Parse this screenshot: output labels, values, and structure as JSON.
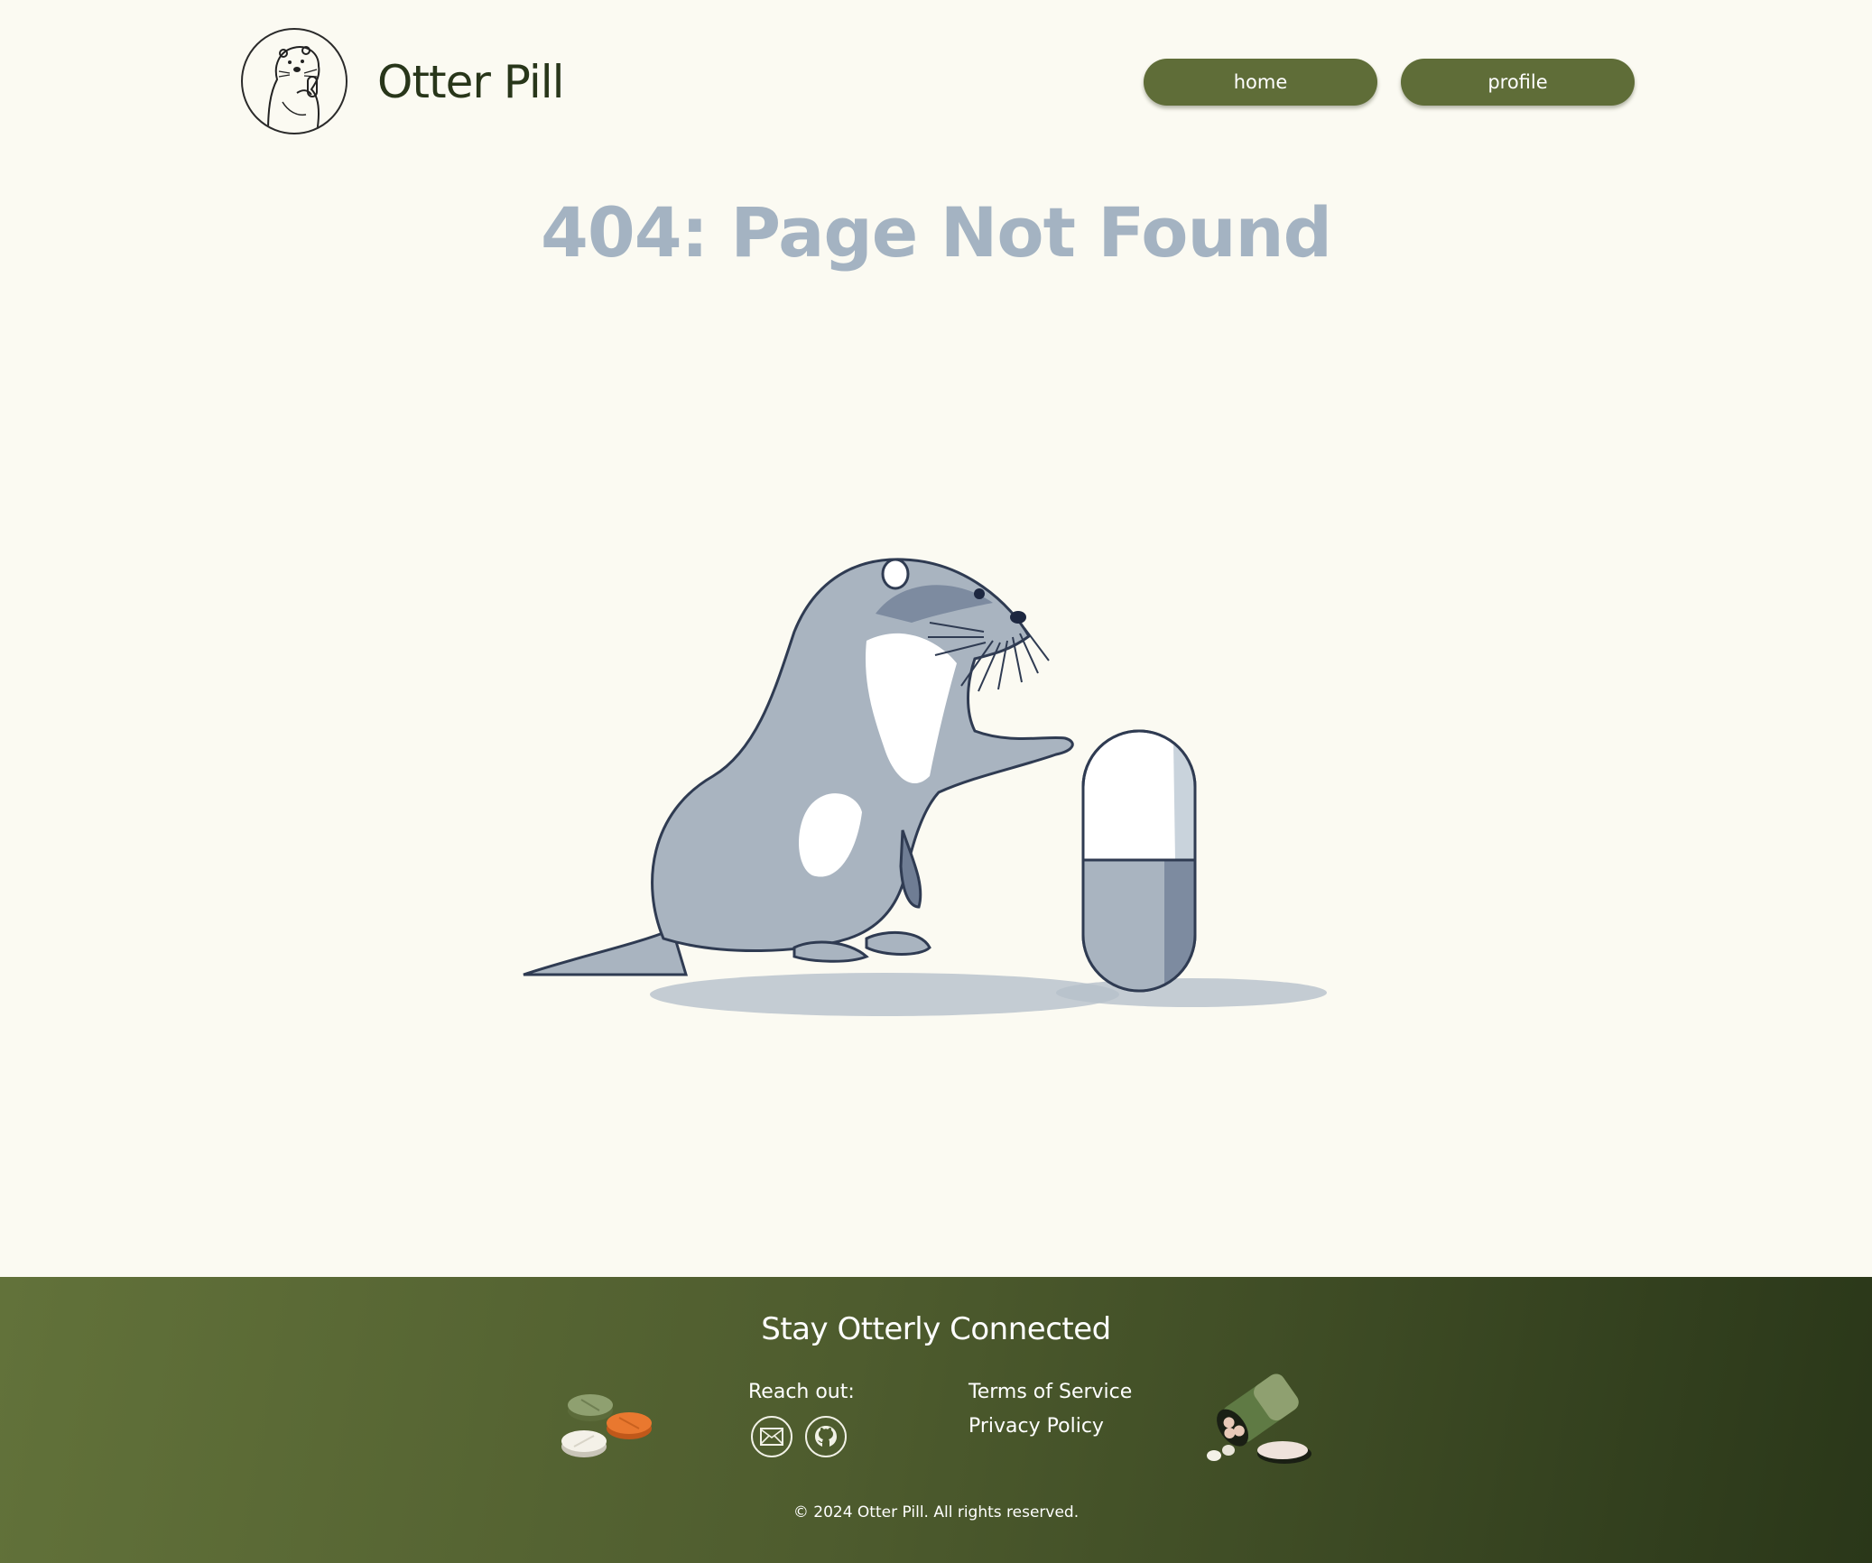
{
  "header": {
    "brand": "Otter Pill",
    "nav": [
      {
        "label": "home"
      },
      {
        "label": "profile"
      }
    ]
  },
  "main": {
    "title": "404: Page Not Found"
  },
  "footer": {
    "title": "Stay Otterly Connected",
    "reach_label": "Reach out:",
    "links": [
      {
        "label": "Terms of Service"
      },
      {
        "label": "Privacy Policy"
      }
    ],
    "copyright": "© 2024 Otter Pill. All rights reserved."
  },
  "colors": {
    "background": "#fbfaf2",
    "accent": "#5f6d38",
    "title": "#a4b3c2",
    "brand_text": "#28361a"
  }
}
